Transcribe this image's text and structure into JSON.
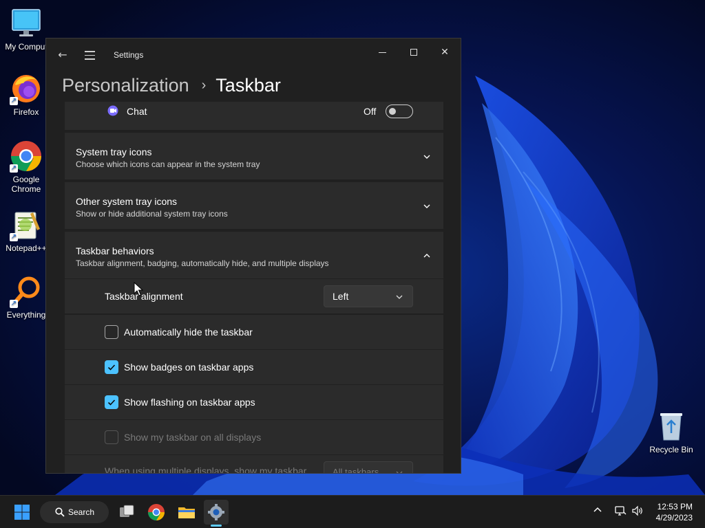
{
  "desktop": {
    "icons": [
      {
        "label": "My Comput",
        "icon": "monitor-icon"
      },
      {
        "label": "Firefox",
        "icon": "firefox-icon"
      },
      {
        "label": "Google Chrome",
        "icon": "chrome-icon"
      },
      {
        "label": "Notepad++",
        "icon": "notepadpp-icon"
      },
      {
        "label": "Everything",
        "icon": "everything-search-icon"
      },
      {
        "label": "Recycle Bin",
        "icon": "recycle-bin-icon"
      }
    ]
  },
  "window": {
    "title": "Settings",
    "breadcrumb": {
      "parent": "Personalization",
      "separator": "›",
      "current": "Taskbar"
    },
    "chat_row": {
      "label": "Chat",
      "state_label": "Off",
      "enabled": false
    },
    "cards": [
      {
        "title": "System tray icons",
        "subtitle": "Choose which icons can appear in the system tray",
        "expanded": false
      },
      {
        "title": "Other system tray icons",
        "subtitle": "Show or hide additional system tray icons",
        "expanded": false
      },
      {
        "title": "Taskbar behaviors",
        "subtitle": "Taskbar alignment, badging, automatically hide, and multiple displays",
        "expanded": true
      }
    ],
    "behaviors": {
      "alignment": {
        "label": "Taskbar alignment",
        "value": "Left"
      },
      "checkboxes": [
        {
          "label": "Automatically hide the taskbar",
          "checked": false,
          "disabled": false
        },
        {
          "label": "Show badges on taskbar apps",
          "checked": true,
          "disabled": false
        },
        {
          "label": "Show flashing on taskbar apps",
          "checked": true,
          "disabled": false
        },
        {
          "label": "Show my taskbar on all displays",
          "checked": false,
          "disabled": true
        }
      ],
      "multi_display": {
        "label": "When using multiple displays, show my taskbar",
        "value": "All taskbars"
      }
    }
  },
  "taskbar": {
    "search_label": "Search",
    "clock_time": "12:53 PM",
    "clock_date": "4/29/2023"
  },
  "colors": {
    "accent": "#4cc2ff",
    "window_bg": "#202020",
    "card_bg": "#2b2b2b"
  }
}
